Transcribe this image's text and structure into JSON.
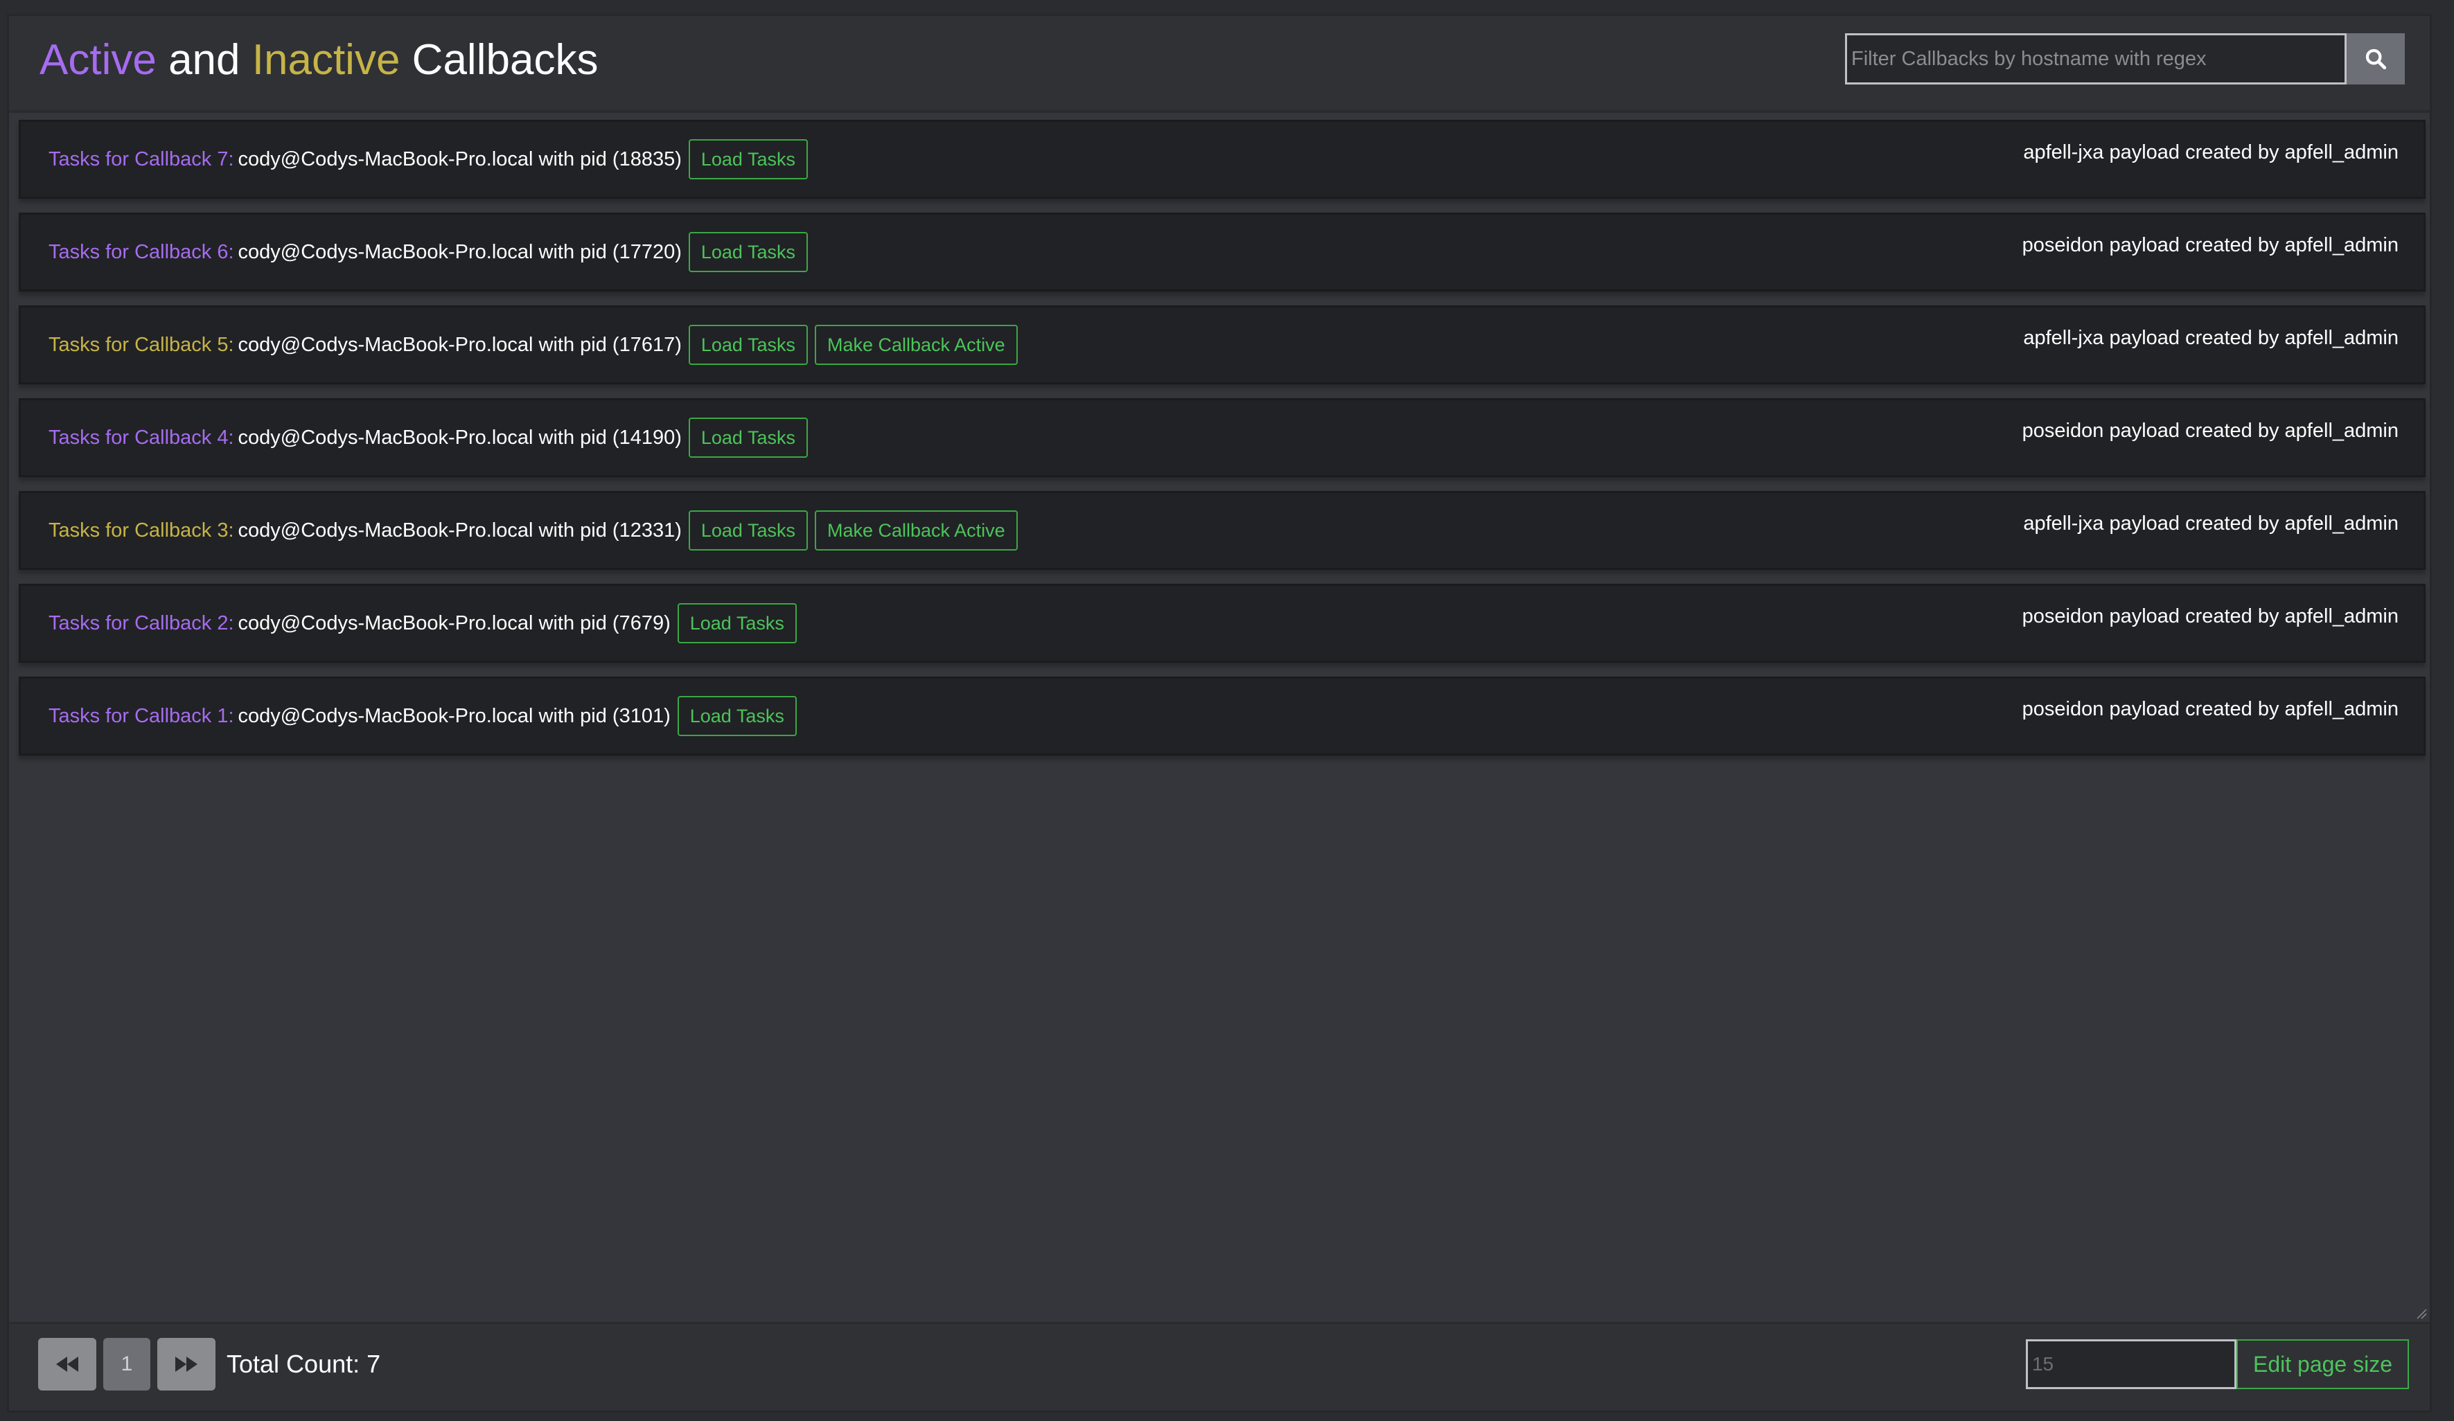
{
  "header": {
    "title_active": "Active",
    "title_and": "and",
    "title_inactive": "Inactive",
    "title_callbacks": "Callbacks",
    "filter_placeholder": "Filter Callbacks by hostname with regex",
    "search_icon": "search-icon"
  },
  "colors": {
    "active": "#a66cf0",
    "inactive": "#c6b447",
    "success": "#4cc45a"
  },
  "callbacks": [
    {
      "label": "Tasks for Callback 7:",
      "status": "active",
      "host": "cody@Codys-MacBook-Pro.local with pid (18835)",
      "load_label": "Load Tasks",
      "make_active_label": "",
      "payload": "apfell-jxa payload created by apfell_admin"
    },
    {
      "label": "Tasks for Callback 6:",
      "status": "active",
      "host": "cody@Codys-MacBook-Pro.local with pid (17720)",
      "load_label": "Load Tasks",
      "make_active_label": "",
      "payload": "poseidon payload created by apfell_admin"
    },
    {
      "label": "Tasks for Callback 5:",
      "status": "inactive",
      "host": "cody@Codys-MacBook-Pro.local with pid (17617)",
      "load_label": "Load Tasks",
      "make_active_label": "Make Callback Active",
      "payload": "apfell-jxa payload created by apfell_admin"
    },
    {
      "label": "Tasks for Callback 4:",
      "status": "active",
      "host": "cody@Codys-MacBook-Pro.local with pid (14190)",
      "load_label": "Load Tasks",
      "make_active_label": "",
      "payload": "poseidon payload created by apfell_admin"
    },
    {
      "label": "Tasks for Callback 3:",
      "status": "inactive",
      "host": "cody@Codys-MacBook-Pro.local with pid (12331)",
      "load_label": "Load Tasks",
      "make_active_label": "Make Callback Active",
      "payload": "apfell-jxa payload created by apfell_admin"
    },
    {
      "label": "Tasks for Callback 2:",
      "status": "active",
      "host": "cody@Codys-MacBook-Pro.local with pid (7679)",
      "load_label": "Load Tasks",
      "make_active_label": "",
      "payload": "poseidon payload created by apfell_admin"
    },
    {
      "label": "Tasks for Callback 1:",
      "status": "active",
      "host": "cody@Codys-MacBook-Pro.local with pid (3101)",
      "load_label": "Load Tasks",
      "make_active_label": "",
      "payload": "poseidon payload created by apfell_admin"
    }
  ],
  "footer": {
    "first_icon": "fast-backward-icon",
    "page_number": "1",
    "next_icon": "fast-forward-icon",
    "total_count": "Total Count: 7",
    "page_size_placeholder": "15",
    "edit_page_size_label": "Edit page size"
  }
}
